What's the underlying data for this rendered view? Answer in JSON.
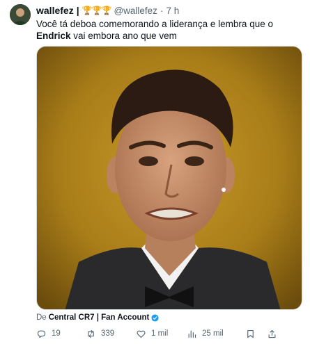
{
  "author": {
    "display_name": "wallefez",
    "separator": "|",
    "badges": "🏆🏆🏆",
    "handle": "@wallefez",
    "dot": "·",
    "time": "7 h"
  },
  "tweet": {
    "text_before": "Você tá deboa comemorando a liderança e lembra que o ",
    "text_bold": "Endrick",
    "text_after": " vai embora ano que vem"
  },
  "source": {
    "prefix": "De",
    "account": "Central CR7 | Fan Account"
  },
  "actions": {
    "replies": "19",
    "retweets": "339",
    "likes": "1 mil",
    "views": "25 mil"
  },
  "icons": {
    "reply": "reply-icon",
    "retweet": "retweet-icon",
    "like": "heart-icon",
    "views": "views-icon",
    "bookmark": "bookmark-icon",
    "share": "share-icon",
    "verified": "verified-badge-icon"
  },
  "colors": {
    "text": "#0f1419",
    "muted": "#536471",
    "verified": "#1d9bf0",
    "media_background": "#b08a20"
  }
}
